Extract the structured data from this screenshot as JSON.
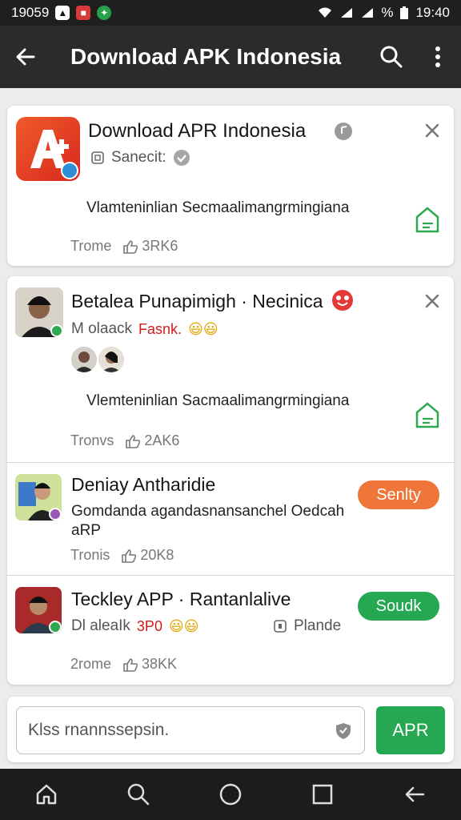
{
  "status_bar": {
    "time_left": "19059",
    "time_right": "19:40",
    "battery": "%"
  },
  "app_bar": {
    "title": "Download APK Indonesia"
  },
  "colors": {
    "app_bar": "#2b2b2b",
    "green": "#26a853",
    "orange": "#f07538",
    "red_tag": "#d11a1a"
  },
  "card1": {
    "title": "Download APR Indonesia",
    "subtitle": "Sanecit:",
    "body": "Vlamteninlian Secmaalimangrmingiana",
    "meta_label": "Trome",
    "likes": "3RK6"
  },
  "card2": {
    "items": [
      {
        "title": "Betalea Punapimigh · Necinica",
        "subtitle": "M olaack",
        "tag": "Fasnk.",
        "body": "Vlemteninlian Sacmaalimangrmingiana",
        "meta_label": "Tronvs",
        "likes": "2AK6"
      },
      {
        "title": "Deniay Antharidie",
        "body_line1": "Gomdanda agandasnansanchel Oedcah",
        "body_line2": "aRP",
        "meta_label": "Tronis",
        "likes": "20K8",
        "button": "Senlty"
      },
      {
        "title": "Teckley APP · Rantanlalive",
        "subtitle": "Dl aleaIk",
        "tag": "3P0",
        "extra": "Plande",
        "meta_label": "2rome",
        "likes": "38KK",
        "button": "Soudk"
      }
    ]
  },
  "composer": {
    "placeholder": "Klss rnannssepsin.",
    "button": "APR"
  }
}
